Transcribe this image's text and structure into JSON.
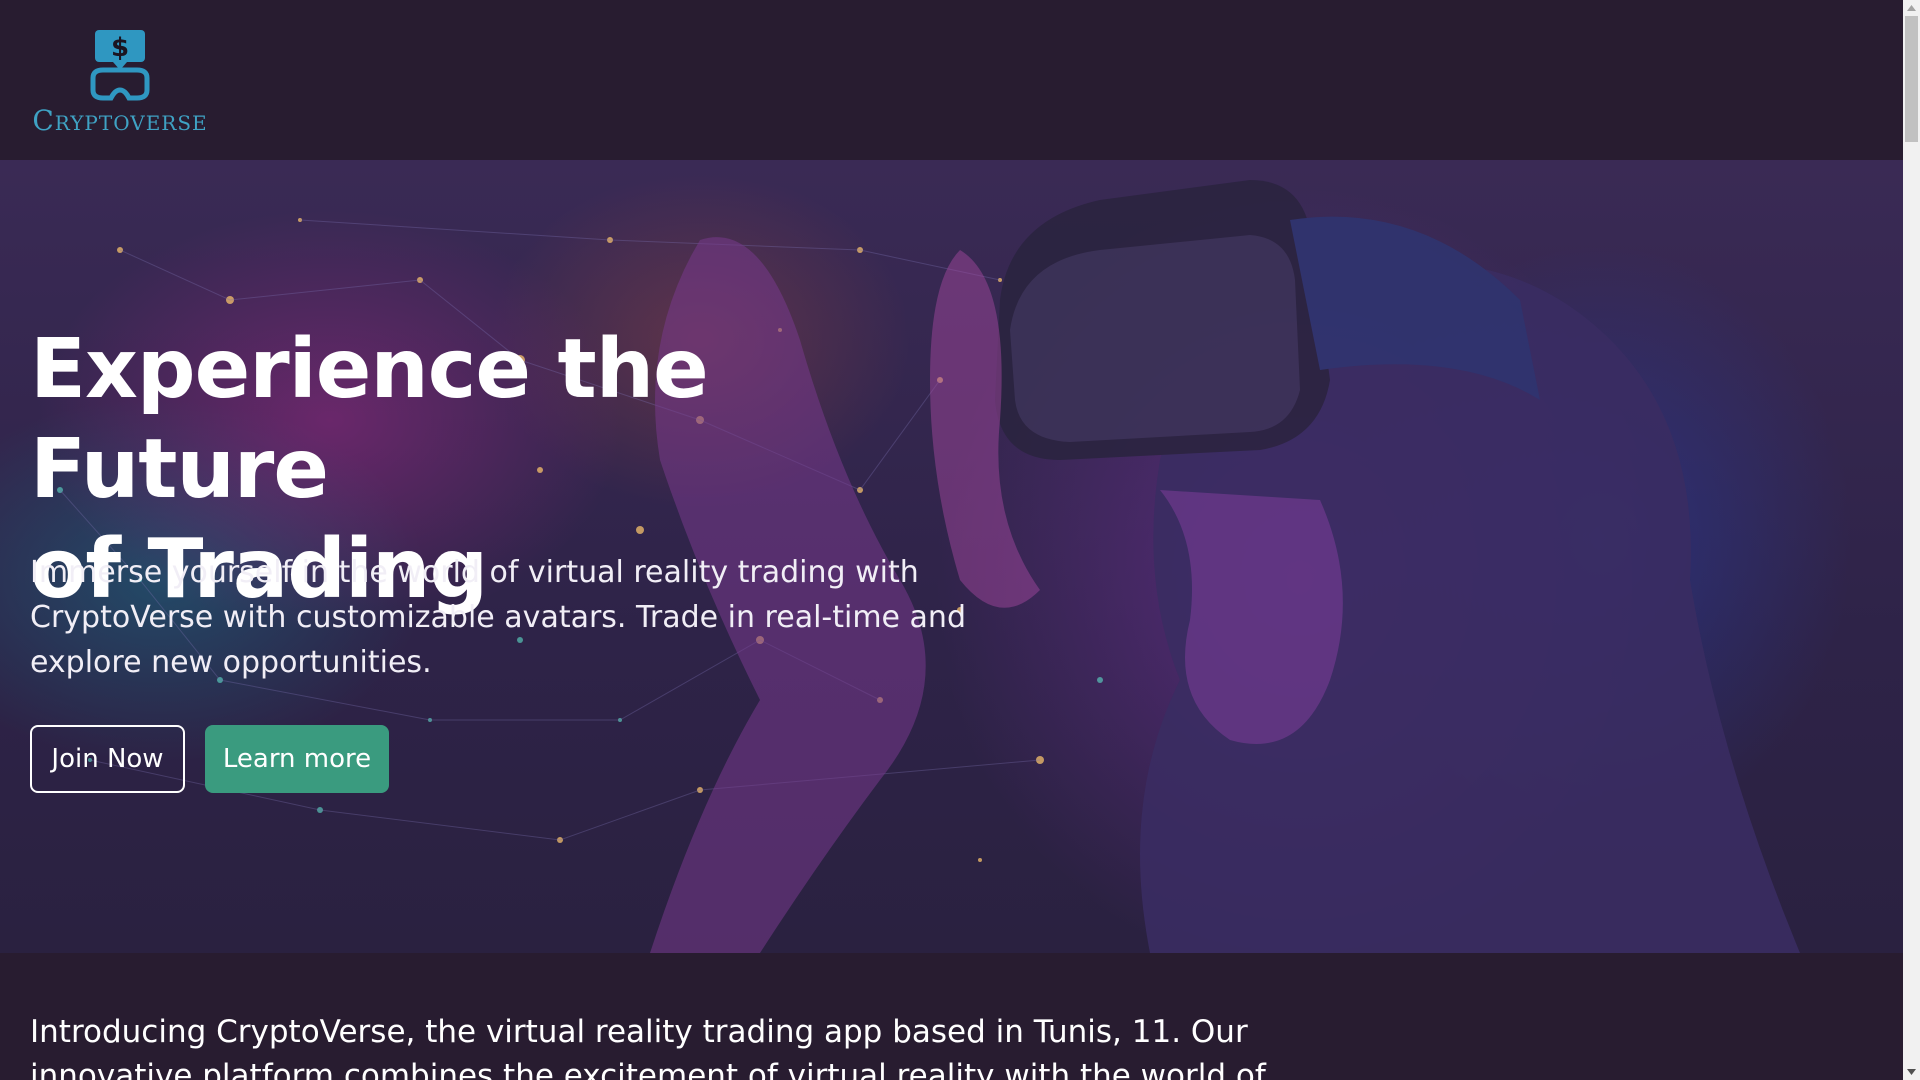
{
  "brand": {
    "name_initial": "C",
    "name_rest": "RYPTOVERSE",
    "logo_symbol": "$",
    "logo_icon": "vr-headset-dollar-icon",
    "color": "#3fa2c4"
  },
  "hero": {
    "title_line1": "Experience the Future",
    "title_line2": "of Trading",
    "subtitle": "Immerse yourself in the world of virtual reality trading with CryptoVerse with customizable avatars. Trade in real-time and explore new opportunities.",
    "join_label": "Join Now",
    "learn_label": "Learn more",
    "accent_color": "#3a9b7f"
  },
  "intro": {
    "text": "Introducing CryptoVerse, the virtual reality trading app based in Tunis, 11. Our innovative platform combines the excitement of virtual reality with the world of"
  },
  "colors": {
    "background": "#281c30",
    "text": "#ffffff"
  }
}
